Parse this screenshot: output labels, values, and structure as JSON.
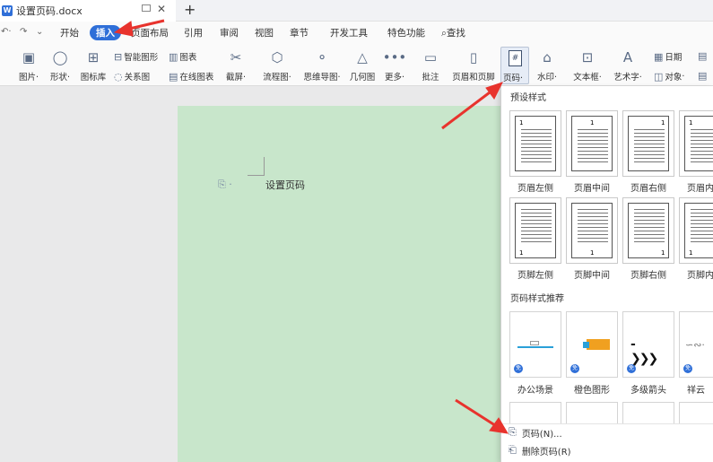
{
  "window": {
    "doc_title": "设置页码.docx"
  },
  "menu": {
    "items": [
      "开始",
      "插入",
      "页面布局",
      "引用",
      "审阅",
      "视图",
      "章节",
      "开发工具",
      "特色功能"
    ],
    "active": "插入",
    "search": "查找"
  },
  "ribbon": {
    "picture": "图片",
    "shape": "形状",
    "icon_lib": "图标库",
    "smart_art": "智能图形",
    "chart": "图表",
    "relation": "关系图",
    "online_chart": "在线图表",
    "screenshot": "截屏",
    "flowchart": "流程图",
    "mindmap": "思维导图",
    "geometry": "几何图",
    "more": "更多",
    "comment": "批注",
    "header_footer": "页眉和页脚",
    "page_number": "页码",
    "watermark": "水印",
    "textbox": "文本框",
    "wordart": "艺术字",
    "date": "日期",
    "object": "对象"
  },
  "document": {
    "text": "设置页码"
  },
  "dropdown": {
    "preset_title": "预设样式",
    "header_presets": [
      {
        "label": "页眉左侧",
        "num": "1",
        "pos": "left"
      },
      {
        "label": "页眉中间",
        "num": "1",
        "pos": "center"
      },
      {
        "label": "页眉右侧",
        "num": "1",
        "pos": "right"
      },
      {
        "label": "页眉内",
        "num": "1",
        "pos": "left"
      }
    ],
    "footer_presets": [
      {
        "label": "页脚左侧",
        "num": "1",
        "pos": "left"
      },
      {
        "label": "页脚中间",
        "num": "1",
        "pos": "center"
      },
      {
        "label": "页脚右侧",
        "num": "1",
        "pos": "right"
      },
      {
        "label": "页脚内",
        "num": "1",
        "pos": "left"
      }
    ],
    "recommend_title": "页码样式推荐",
    "recommend": [
      {
        "label": "办公场景"
      },
      {
        "label": "橙色图形"
      },
      {
        "label": "多级箭头"
      },
      {
        "label": "祥云"
      }
    ],
    "free_badge": "免",
    "menu": [
      {
        "label": "页码(N)...",
        "icon": "page-number-icon"
      },
      {
        "label": "删除页码(R)",
        "icon": "delete-page-number-icon"
      }
    ]
  },
  "colors": {
    "accent": "#2f6fd8",
    "page_bg": "#c8e6cb",
    "arrow": "#e8332d"
  }
}
